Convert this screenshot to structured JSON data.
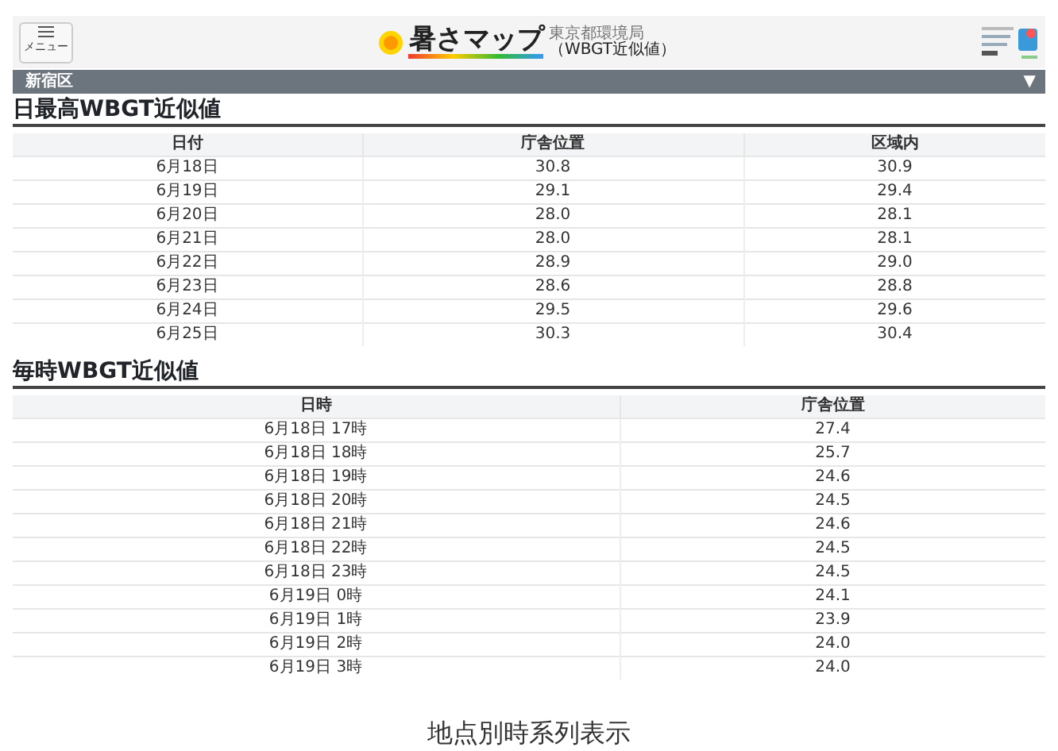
{
  "header": {
    "menu_button": "メニュー",
    "logo": {
      "title": "暑さマップ",
      "agency": "東京都環境局",
      "subtitle": "（WBGT近似値）"
    }
  },
  "region_select": {
    "value": "新宿区",
    "caret": "▼"
  },
  "daily_table": {
    "title": "日最高WBGT近似値",
    "columns": [
      "日付",
      "庁舎位置",
      "区域内"
    ],
    "rows": [
      [
        "6月18日",
        "30.8",
        "30.9"
      ],
      [
        "6月19日",
        "29.1",
        "29.4"
      ],
      [
        "6月20日",
        "28.0",
        "28.1"
      ],
      [
        "6月21日",
        "28.0",
        "28.1"
      ],
      [
        "6月22日",
        "28.9",
        "29.0"
      ],
      [
        "6月23日",
        "28.6",
        "28.8"
      ],
      [
        "6月24日",
        "29.5",
        "29.6"
      ],
      [
        "6月25日",
        "30.3",
        "30.4"
      ]
    ]
  },
  "hourly_table": {
    "title": "毎時WBGT近似値",
    "columns": [
      "日時",
      "庁舎位置"
    ],
    "rows": [
      [
        "6月18日 17時",
        "27.4"
      ],
      [
        "6月18日 18時",
        "25.7"
      ],
      [
        "6月18日 19時",
        "24.6"
      ],
      [
        "6月18日 20時",
        "24.5"
      ],
      [
        "6月18日 21時",
        "24.6"
      ],
      [
        "6月18日 22時",
        "24.5"
      ],
      [
        "6月18日 23時",
        "24.5"
      ],
      [
        "6月19日 0時",
        "24.1"
      ],
      [
        "6月19日 1時",
        "23.9"
      ],
      [
        "6月19日 2時",
        "24.0"
      ],
      [
        "6月19日 3時",
        "24.0"
      ]
    ]
  },
  "caption": "地点別時系列表示"
}
